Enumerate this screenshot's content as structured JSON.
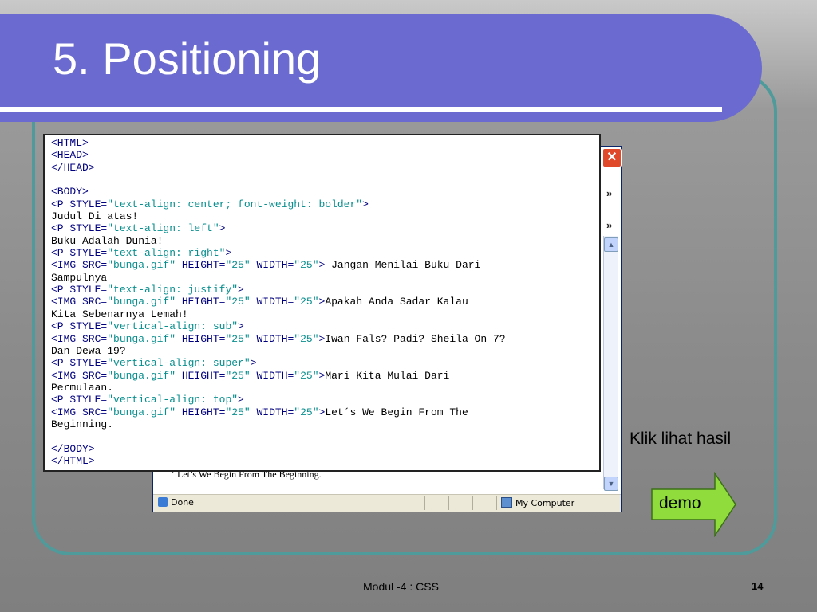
{
  "slide": {
    "title": "5. Positioning",
    "footer": "Modul -4 : CSS",
    "page_number": "14",
    "klik_label": "Klik lihat hasil",
    "demo_label": "demo"
  },
  "browser": {
    "close_label": "✕",
    "chevron_label": "»",
    "behind_text": "‘ Let’s We Begin From The Beginning.",
    "status_done": "Done",
    "status_zone": "My Computer"
  },
  "code_lines": [
    [
      [
        "t",
        "<HTML>"
      ]
    ],
    [
      [
        "t",
        "<HEAD>"
      ]
    ],
    [
      [
        "t",
        "</HEAD>"
      ]
    ],
    [],
    [
      [
        "t",
        "<BODY>"
      ]
    ],
    [
      [
        "t",
        "<P STYLE="
      ],
      [
        "s",
        "\"text-align: center; font-weight: bolder\""
      ],
      [
        "t",
        ">"
      ]
    ],
    [
      [
        "p",
        "Judul Di atas!"
      ]
    ],
    [
      [
        "t",
        "<P STYLE="
      ],
      [
        "s",
        "\"text-align: left\""
      ],
      [
        "t",
        ">"
      ]
    ],
    [
      [
        "p",
        "Buku Adalah Dunia!"
      ]
    ],
    [
      [
        "t",
        "<P STYLE="
      ],
      [
        "s",
        "\"text-align: right\""
      ],
      [
        "t",
        ">"
      ]
    ],
    [
      [
        "t",
        "<IMG SRC="
      ],
      [
        "s",
        "\"bunga.gif\""
      ],
      [
        "t",
        " HEIGHT="
      ],
      [
        "s",
        "\"25\""
      ],
      [
        "t",
        " WIDTH="
      ],
      [
        "s",
        "\"25\""
      ],
      [
        "t",
        ">"
      ],
      [
        "p",
        " Jangan Menilai Buku Dari"
      ]
    ],
    [
      [
        "p",
        "Sampulnya"
      ]
    ],
    [
      [
        "t",
        "<P STYLE="
      ],
      [
        "s",
        "\"text-align: justify\""
      ],
      [
        "t",
        ">"
      ]
    ],
    [
      [
        "t",
        "<IMG SRC="
      ],
      [
        "s",
        "\"bunga.gif\""
      ],
      [
        "t",
        " HEIGHT="
      ],
      [
        "s",
        "\"25\""
      ],
      [
        "t",
        " WIDTH="
      ],
      [
        "s",
        "\"25\""
      ],
      [
        "t",
        ">"
      ],
      [
        "p",
        "Apakah Anda Sadar Kalau"
      ]
    ],
    [
      [
        "p",
        "Kita Sebenarnya Lemah!"
      ]
    ],
    [
      [
        "t",
        "<P STYLE="
      ],
      [
        "s",
        "\"vertical-align: sub\""
      ],
      [
        "t",
        ">"
      ]
    ],
    [
      [
        "t",
        "<IMG SRC="
      ],
      [
        "s",
        "\"bunga.gif\""
      ],
      [
        "t",
        " HEIGHT="
      ],
      [
        "s",
        "\"25\""
      ],
      [
        "t",
        " WIDTH="
      ],
      [
        "s",
        "\"25\""
      ],
      [
        "t",
        ">"
      ],
      [
        "p",
        "Iwan Fals? Padi? Sheila On 7?"
      ]
    ],
    [
      [
        "p",
        "Dan Dewa 19?"
      ]
    ],
    [
      [
        "t",
        "<P STYLE="
      ],
      [
        "s",
        "\"vertical-align: super\""
      ],
      [
        "t",
        ">"
      ]
    ],
    [
      [
        "t",
        "<IMG SRC="
      ],
      [
        "s",
        "\"bunga.gif\""
      ],
      [
        "t",
        " HEIGHT="
      ],
      [
        "s",
        "\"25\""
      ],
      [
        "t",
        " WIDTH="
      ],
      [
        "s",
        "\"25\""
      ],
      [
        "t",
        ">"
      ],
      [
        "p",
        "Mari Kita Mulai Dari"
      ]
    ],
    [
      [
        "p",
        "Permulaan."
      ]
    ],
    [
      [
        "t",
        "<P STYLE="
      ],
      [
        "s",
        "\"vertical-align: top\""
      ],
      [
        "t",
        ">"
      ]
    ],
    [
      [
        "t",
        "<IMG SRC="
      ],
      [
        "s",
        "\"bunga.gif\""
      ],
      [
        "t",
        " HEIGHT="
      ],
      [
        "s",
        "\"25\""
      ],
      [
        "t",
        " WIDTH="
      ],
      [
        "s",
        "\"25\""
      ],
      [
        "t",
        ">"
      ],
      [
        "p",
        "Let´s We Begin From The"
      ]
    ],
    [
      [
        "p",
        "Beginning."
      ]
    ],
    [],
    [
      [
        "t",
        "</BODY>"
      ]
    ],
    [
      [
        "t",
        "</HTML>"
      ]
    ]
  ],
  "colors": {
    "title_bar": "#6a6ad0",
    "frame_border": "#4f9a9a",
    "code_tag": "#00007f",
    "code_string": "#0a8f8f",
    "demo_arrow": "#8fdc3c"
  }
}
